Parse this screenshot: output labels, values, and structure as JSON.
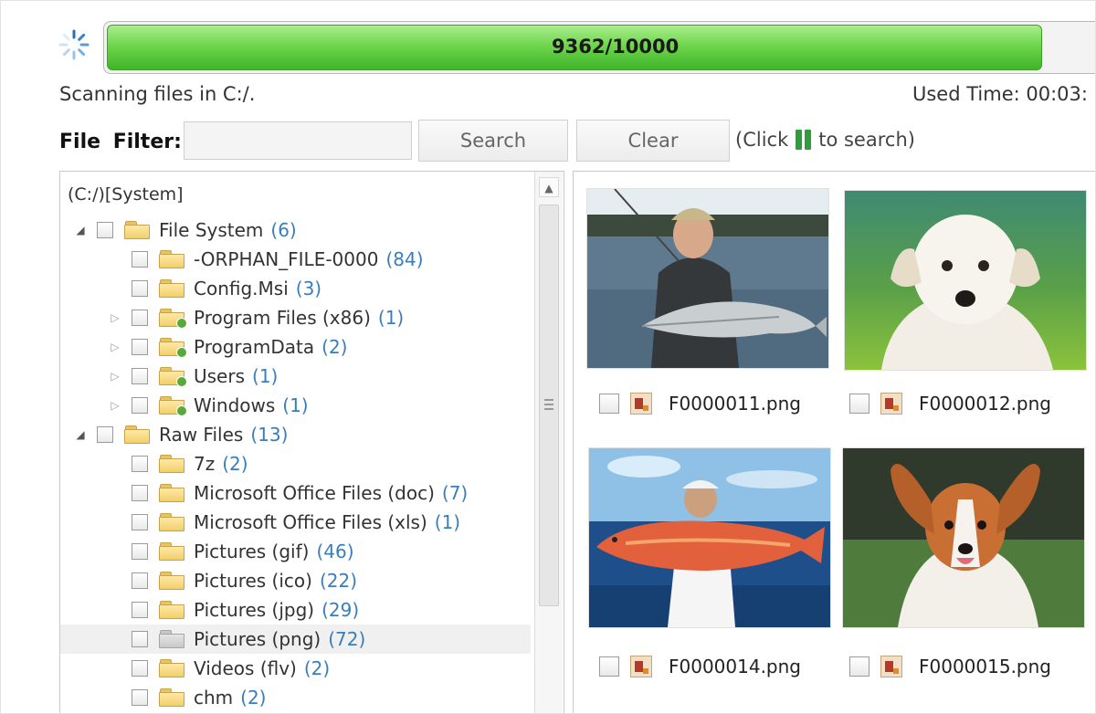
{
  "progress": {
    "label": "9362/10000",
    "value": 0.9362
  },
  "status": {
    "scanning": "Scanning files in C:/.",
    "used_time": "Used Time: 00:03:"
  },
  "filter": {
    "label": "File  Filter:",
    "input_value": "",
    "search_label": "Search",
    "clear_label": "Clear",
    "hint_before": "(Click",
    "hint_after": "to search)"
  },
  "tree": {
    "header": "(C:/)[System]",
    "items": [
      {
        "label": "File System",
        "count": "(6)",
        "level": 0,
        "expander": "expanded",
        "icon": "folder-icon"
      },
      {
        "label": "-ORPHAN_FILE-0000",
        "count": "(84)",
        "level": 1,
        "expander": "none",
        "icon": "folder-icon"
      },
      {
        "label": "Config.Msi",
        "count": "(3)",
        "level": 1,
        "expander": "none",
        "icon": "folder-icon"
      },
      {
        "label": "Program Files (x86)",
        "count": "(1)",
        "level": 1,
        "expander": "collapsed",
        "icon": "folder-badge-icon"
      },
      {
        "label": "ProgramData",
        "count": "(2)",
        "level": 1,
        "expander": "collapsed",
        "icon": "folder-badge-icon"
      },
      {
        "label": "Users",
        "count": "(1)",
        "level": 1,
        "expander": "collapsed",
        "icon": "folder-badge-icon"
      },
      {
        "label": "Windows",
        "count": "(1)",
        "level": 1,
        "expander": "collapsed",
        "icon": "folder-badge-icon"
      },
      {
        "label": "Raw Files",
        "count": "(13)",
        "level": 0,
        "expander": "expanded",
        "icon": "folder-icon"
      },
      {
        "label": "7z",
        "count": "(2)",
        "level": 1,
        "expander": "none",
        "icon": "folder-icon"
      },
      {
        "label": "Microsoft Office Files (doc)",
        "count": "(7)",
        "level": 1,
        "expander": "none",
        "icon": "folder-icon"
      },
      {
        "label": "Microsoft Office Files (xls)",
        "count": "(1)",
        "level": 1,
        "expander": "none",
        "icon": "folder-icon"
      },
      {
        "label": "Pictures (gif)",
        "count": "(46)",
        "level": 1,
        "expander": "none",
        "icon": "folder-icon"
      },
      {
        "label": "Pictures (ico)",
        "count": "(22)",
        "level": 1,
        "expander": "none",
        "icon": "folder-icon"
      },
      {
        "label": "Pictures (jpg)",
        "count": "(29)",
        "level": 1,
        "expander": "none",
        "icon": "folder-icon"
      },
      {
        "label": "Pictures (png)",
        "count": "(72)",
        "level": 1,
        "expander": "none",
        "icon": "folder-grey-icon",
        "selected": true
      },
      {
        "label": "Videos (flv)",
        "count": "(2)",
        "level": 1,
        "expander": "none",
        "icon": "folder-icon"
      },
      {
        "label": "chm",
        "count": "(2)",
        "level": 1,
        "expander": "none",
        "icon": "folder-icon"
      }
    ]
  },
  "thumbnails": [
    {
      "filename": "F0000011.png",
      "image": "fisherman-holding-fish-photo"
    },
    {
      "filename": "F0000012.png",
      "image": "white-puppy-photo"
    },
    {
      "filename": "F0000014.png",
      "image": "man-holding-red-fish-photo"
    },
    {
      "filename": "F0000015.png",
      "image": "papillon-dog-photo"
    }
  ]
}
